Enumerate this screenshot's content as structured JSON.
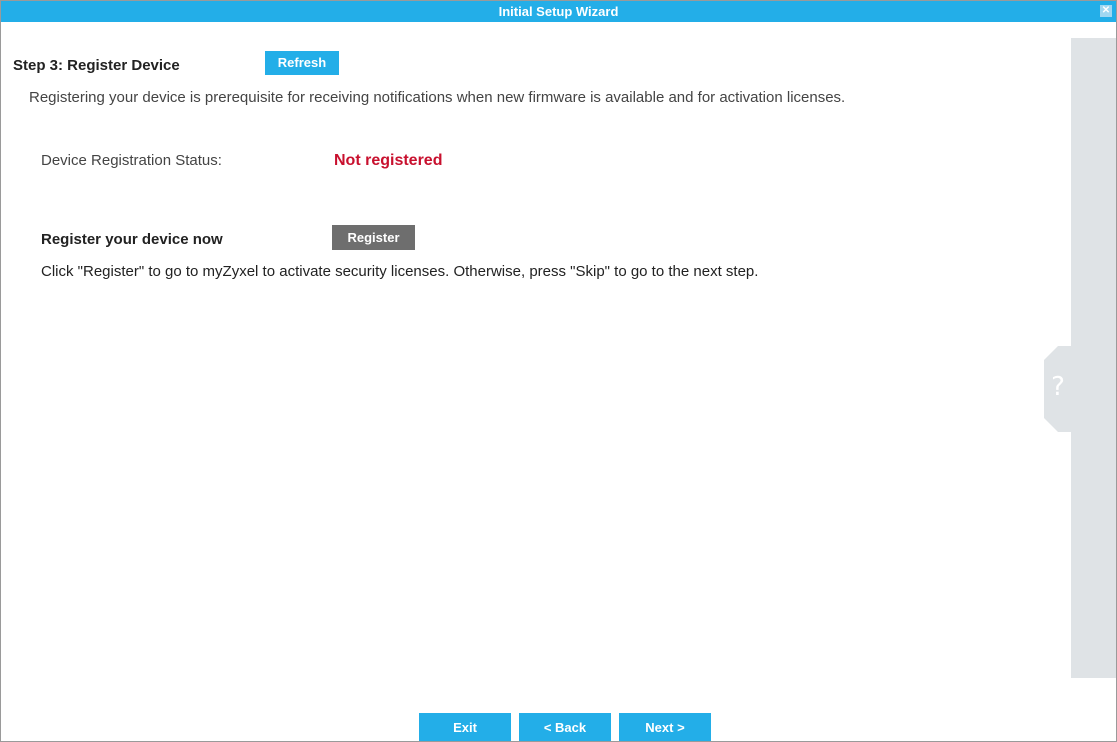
{
  "window": {
    "title": "Initial Setup Wizard",
    "close_glyph": "✕"
  },
  "step": {
    "title": "Step 3: Register Device",
    "refresh_label": "Refresh",
    "intro": "Registering your device is prerequisite for receiving notifications when new firmware is available and for activation licenses."
  },
  "status": {
    "label": "Device Registration Status:",
    "value": "Not registered"
  },
  "register": {
    "label": "Register your device now",
    "button_label": "Register",
    "description": "Click \"Register\" to go to myZyxel to activate security licenses. Otherwise, press \"Skip\" to go to the next step."
  },
  "help": {
    "glyph": "?"
  },
  "footer": {
    "exit_label": "Exit",
    "back_label": "< Back",
    "next_label": "Next >"
  },
  "colors": {
    "accent": "#23aee8",
    "status_error": "#c8102e",
    "secondary_button": "#6e6e6e",
    "help_panel": "#dfe3e6"
  },
  "icons": {
    "close": "close-icon",
    "help": "help-icon"
  }
}
